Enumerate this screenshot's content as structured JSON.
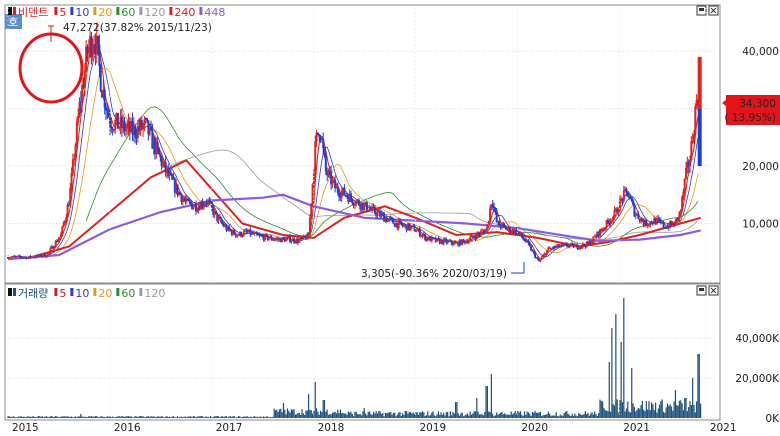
{
  "header": {
    "title": "비덴트",
    "ma_labels": [
      "5",
      "10",
      "20",
      "60",
      "120",
      "240",
      "448"
    ],
    "ma_colors": [
      "#d32020",
      "#2a3cc8",
      "#e59a17",
      "#2e8b2e",
      "#9a9a9a",
      "#e02020",
      "#8c5ce0"
    ],
    "volume_title": "거래량",
    "volume_ma_labels": [
      "5",
      "10",
      "20",
      "60",
      "120"
    ],
    "side_tab": "호"
  },
  "annotations": {
    "high": "47,272(37.82% 2015/11/23)",
    "low": "3,305(-90.36% 2020/03/19)",
    "last_price": "34,300",
    "last_change": "( 13.95%)"
  },
  "colors": {
    "candle_up": "#e0241b",
    "candle_down": "#1e3fd0",
    "highlight_circle": "#e3141a",
    "volume_fill": "#1d4f7a"
  },
  "chart_data": [
    {
      "type": "candlestick",
      "name": "price",
      "y_ticks": [
        "40,000",
        "30,000",
        "20,000",
        "10,000"
      ],
      "ylim": [
        0,
        47500
      ],
      "x_ticks": [
        "2015",
        "2016",
        "2017",
        "2018",
        "2019",
        "2020",
        "2021",
        "2021"
      ],
      "x_range": [
        2015.0,
        2021.95
      ],
      "points": [
        [
          2015.0,
          4200
        ],
        [
          2015.2,
          4100
        ],
        [
          2015.38,
          4500
        ],
        [
          2015.52,
          8000
        ],
        [
          2015.6,
          14000
        ],
        [
          2015.7,
          30000
        ],
        [
          2015.78,
          40000
        ],
        [
          2015.85,
          43000
        ],
        [
          2015.92,
          34000
        ],
        [
          2016.0,
          28000
        ],
        [
          2016.1,
          27000
        ],
        [
          2016.22,
          26000
        ],
        [
          2016.35,
          27000
        ],
        [
          2016.45,
          23000
        ],
        [
          2016.55,
          19000
        ],
        [
          2016.65,
          16000
        ],
        [
          2016.75,
          13500
        ],
        [
          2016.85,
          13000
        ],
        [
          2016.95,
          14000
        ],
        [
          2017.05,
          11000
        ],
        [
          2017.15,
          9000
        ],
        [
          2017.25,
          8000
        ],
        [
          2017.35,
          8500
        ],
        [
          2017.45,
          7800
        ],
        [
          2017.55,
          7500
        ],
        [
          2017.65,
          7200
        ],
        [
          2017.75,
          7300
        ],
        [
          2017.85,
          7000
        ],
        [
          2017.95,
          7800
        ],
        [
          2018.02,
          24000
        ],
        [
          2018.06,
          27000
        ],
        [
          2018.12,
          19000
        ],
        [
          2018.22,
          16000
        ],
        [
          2018.32,
          15000
        ],
        [
          2018.4,
          14000
        ],
        [
          2018.5,
          13000
        ],
        [
          2018.6,
          12000
        ],
        [
          2018.7,
          11000
        ],
        [
          2018.8,
          10000
        ],
        [
          2018.9,
          9500
        ],
        [
          2019.0,
          9000
        ],
        [
          2019.1,
          7500
        ],
        [
          2019.2,
          7000
        ],
        [
          2019.3,
          6800
        ],
        [
          2019.4,
          6500
        ],
        [
          2019.5,
          7000
        ],
        [
          2019.6,
          8000
        ],
        [
          2019.7,
          9000
        ],
        [
          2019.75,
          14500
        ],
        [
          2019.8,
          10000
        ],
        [
          2019.9,
          9000
        ],
        [
          2020.0,
          8500
        ],
        [
          2020.1,
          6500
        ],
        [
          2020.21,
          3305
        ],
        [
          2020.3,
          5500
        ],
        [
          2020.4,
          6000
        ],
        [
          2020.5,
          6200
        ],
        [
          2020.6,
          6000
        ],
        [
          2020.7,
          6500
        ],
        [
          2020.78,
          8000
        ],
        [
          2020.88,
          10000
        ],
        [
          2020.97,
          12000
        ],
        [
          2021.03,
          14500
        ],
        [
          2021.08,
          15500
        ],
        [
          2021.15,
          12000
        ],
        [
          2021.25,
          10000
        ],
        [
          2021.35,
          10500
        ],
        [
          2021.45,
          9500
        ],
        [
          2021.55,
          10000
        ],
        [
          2021.6,
          12000
        ],
        [
          2021.65,
          18000
        ],
        [
          2021.7,
          22000
        ],
        [
          2021.75,
          30000
        ],
        [
          2021.78,
          34300
        ]
      ],
      "ma_long_448": [
        [
          2015.0,
          3800
        ],
        [
          2015.5,
          4500
        ],
        [
          2016.0,
          9000
        ],
        [
          2016.5,
          12000
        ],
        [
          2017.0,
          14000
        ],
        [
          2017.5,
          14500
        ],
        [
          2017.7,
          15000
        ],
        [
          2018.0,
          13000
        ],
        [
          2018.5,
          11000
        ],
        [
          2019.0,
          10500
        ],
        [
          2019.5,
          10000
        ],
        [
          2020.0,
          9200
        ],
        [
          2020.5,
          7800
        ],
        [
          2020.8,
          7000
        ],
        [
          2021.2,
          7200
        ],
        [
          2021.6,
          8000
        ],
        [
          2021.8,
          8800
        ]
      ],
      "ma_240": [
        [
          2015.2,
          4000
        ],
        [
          2015.6,
          6000
        ],
        [
          2016.0,
          12000
        ],
        [
          2016.4,
          18000
        ],
        [
          2016.75,
          21000
        ],
        [
          2017.0,
          16000
        ],
        [
          2017.3,
          10000
        ],
        [
          2017.7,
          8000
        ],
        [
          2018.0,
          7500
        ],
        [
          2018.3,
          11000
        ],
        [
          2018.7,
          13000
        ],
        [
          2019.0,
          11000
        ],
        [
          2019.4,
          8000
        ],
        [
          2019.8,
          8500
        ],
        [
          2020.2,
          7500
        ],
        [
          2020.6,
          6000
        ],
        [
          2020.9,
          6800
        ],
        [
          2021.2,
          8000
        ],
        [
          2021.5,
          9500
        ],
        [
          2021.8,
          11000
        ]
      ]
    },
    {
      "type": "bar",
      "name": "volume",
      "y_ticks": [
        "40,000K",
        "20,000K",
        "0K"
      ],
      "ylim": [
        0,
        60000
      ],
      "spikes": [
        [
          2015.72,
          2000
        ],
        [
          2017.7,
          7500
        ],
        [
          2017.95,
          12000
        ],
        [
          2018.02,
          18000
        ],
        [
          2018.1,
          9000
        ],
        [
          2018.5,
          5000
        ],
        [
          2019.4,
          8000
        ],
        [
          2019.6,
          10000
        ],
        [
          2019.7,
          16000
        ],
        [
          2019.75,
          22000
        ],
        [
          2020.85,
          5000
        ],
        [
          2020.9,
          28000
        ],
        [
          2020.93,
          45000
        ],
        [
          2020.97,
          52000
        ],
        [
          2021.02,
          38000
        ],
        [
          2021.05,
          60000
        ],
        [
          2021.12,
          25000
        ],
        [
          2021.55,
          14000
        ],
        [
          2021.65,
          10000
        ],
        [
          2021.72,
          20000
        ],
        [
          2021.78,
          32000
        ]
      ]
    }
  ]
}
